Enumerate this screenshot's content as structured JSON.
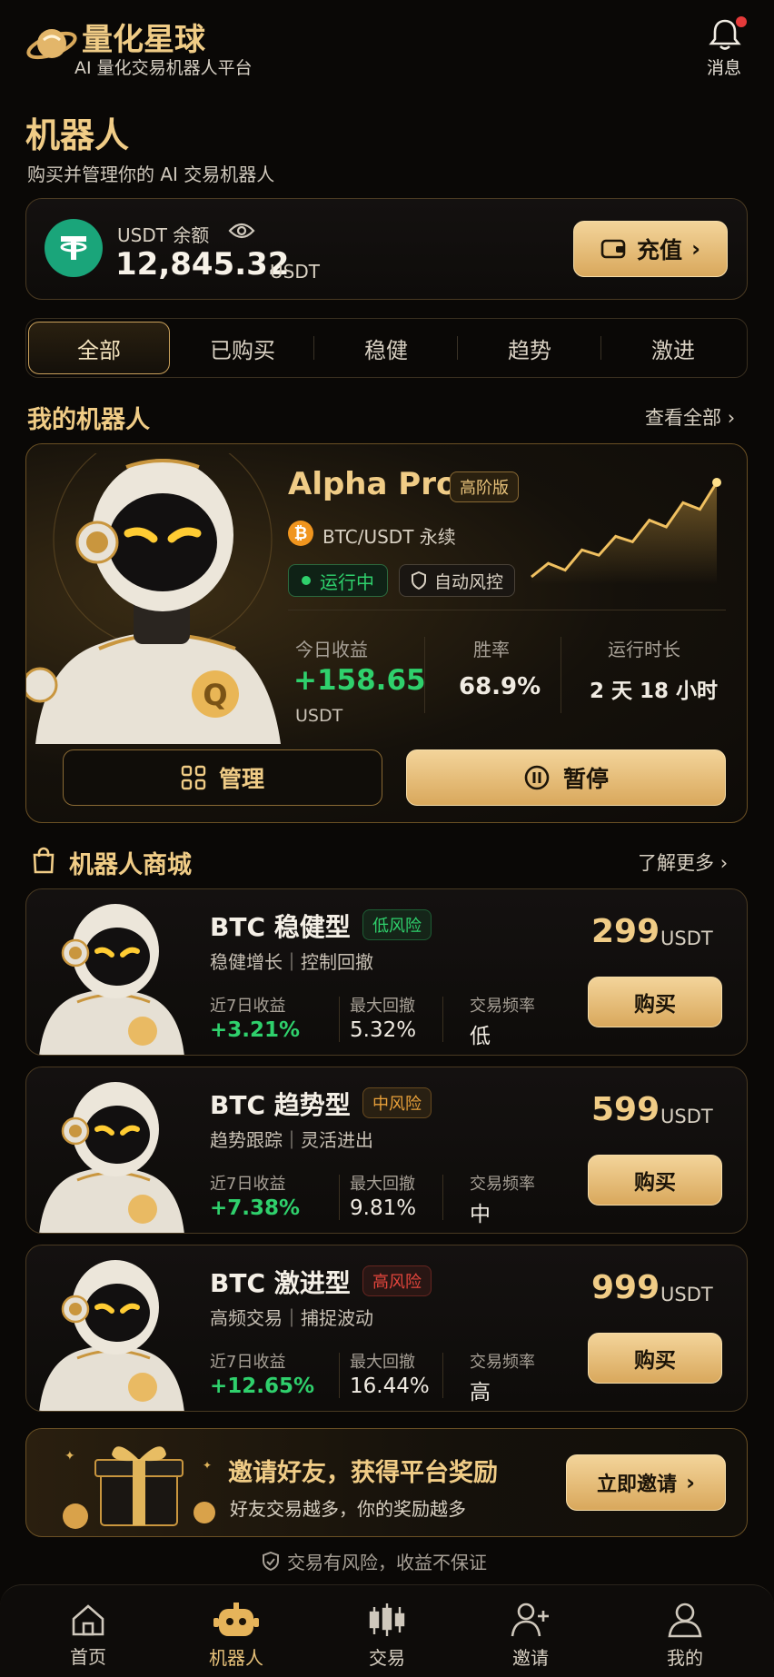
{
  "header": {
    "app_name": "量化星球",
    "tagline": "AI 量化交易机器人平台",
    "messages_label": "消息"
  },
  "page": {
    "title": "机器人",
    "subtitle": "购买并管理你的 AI 交易机器人"
  },
  "balance": {
    "label": "USDT 余额",
    "amount": "12,845.32",
    "unit": "USDT",
    "recharge_label": "充值"
  },
  "tabs": [
    "全部",
    "已购买",
    "稳健",
    "趋势",
    "激进"
  ],
  "my_robots": {
    "section_title": "我的机器人",
    "view_all": "查看全部",
    "robot": {
      "name": "Alpha Pro",
      "tier": "高阶版",
      "pair": "BTC/USDT 永续",
      "status": "运行中",
      "risk_control": "自动风控",
      "today_label": "今日收益",
      "today_value": "+158.65",
      "today_unit": "USDT",
      "winrate_label": "胜率",
      "winrate_value": "68.9%",
      "runtime_label": "运行时长",
      "runtime_value": "2 天 18 小时",
      "manage_label": "管理",
      "pause_label": "暂停",
      "sparkline": [
        2,
        3,
        2.5,
        4,
        3.6,
        5,
        4.6,
        6.2,
        5.7,
        7.5,
        7,
        9
      ]
    }
  },
  "store": {
    "section_title": "机器人商城",
    "learn_more": "了解更多",
    "products": [
      {
        "name": "BTC 稳健型",
        "risk": "低风险",
        "risk_color": "#2fd06c",
        "desc": "稳健增长｜控制回撤",
        "return_label": "近7日收益",
        "return": "+3.21%",
        "dd_label": "最大回撤",
        "dd": "5.32%",
        "freq_label": "交易频率",
        "freq": "低",
        "price": "299",
        "unit": "USDT",
        "buy": "购买"
      },
      {
        "name": "BTC 趋势型",
        "risk": "中风险",
        "risk_color": "#e8a03a",
        "desc": "趋势跟踪｜灵活进出",
        "return_label": "近7日收益",
        "return": "+7.38%",
        "dd_label": "最大回撤",
        "dd": "9.81%",
        "freq_label": "交易频率",
        "freq": "中",
        "price": "599",
        "unit": "USDT",
        "buy": "购买"
      },
      {
        "name": "BTC 激进型",
        "risk": "高风险",
        "risk_color": "#e2453c",
        "desc": "高频交易｜捕捉波动",
        "return_label": "近7日收益",
        "return": "+12.65%",
        "dd_label": "最大回撤",
        "dd": "16.44%",
        "freq_label": "交易频率",
        "freq": "高",
        "price": "999",
        "unit": "USDT",
        "buy": "购买"
      }
    ]
  },
  "invite": {
    "title": "邀请好友，获得平台奖励",
    "subtitle": "好友交易越多，你的奖励越多",
    "button": "立即邀请"
  },
  "disclaimer": "交易有风险，收益不保证",
  "nav": {
    "items": [
      "首页",
      "机器人",
      "交易",
      "邀请",
      "我的"
    ],
    "active_color": "#e8c27a"
  }
}
